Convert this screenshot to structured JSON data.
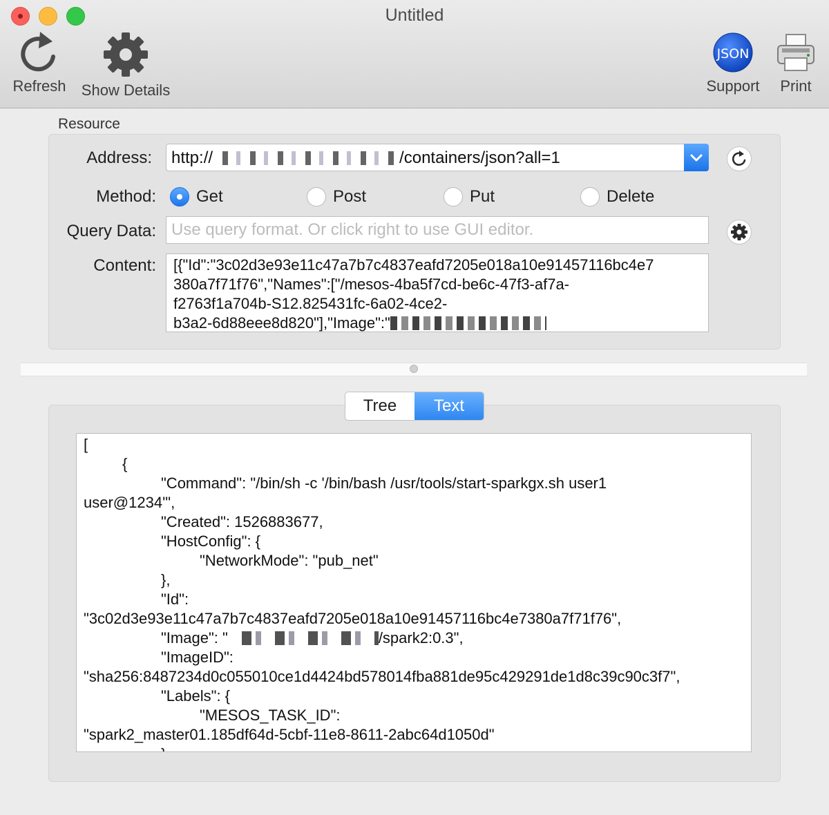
{
  "window": {
    "title": "Untitled"
  },
  "toolbar": {
    "refresh_label": "Refresh",
    "details_label": "Show Details",
    "support_label": "Support",
    "print_label": "Print",
    "support_badge": "JSON"
  },
  "resource": {
    "group_title": "Resource",
    "address_label": "Address:",
    "address_prefix": "http://",
    "address_suffix": "/containers/json?all=1",
    "method_label": "Method:",
    "methods": [
      "Get",
      "Post",
      "Put",
      "Delete"
    ],
    "selected_method": "Get",
    "query_label": "Query Data:",
    "query_placeholder": "Use query format. Or click right to use GUI editor.",
    "query_value": "",
    "content_label": "Content:",
    "content_lines": [
      "[{\"Id\":\"3c02d3e93e11c47a7b7c4837eafd7205e018a10e91457116bc4e7",
      "380a7f71f76\",\"Names\":[\"/mesos-4ba5f7cd-be6c-47f3-af7a-",
      "f2763f1a704b-S12.825431fc-6a02-4ce2-",
      "b3a2-6d88eee8d820\"],\"Image\":\""
    ]
  },
  "view_tabs": {
    "tree": "Tree",
    "text": "Text",
    "active": "Text"
  },
  "result": {
    "lines": [
      "[",
      "{",
      "\"Command\": \"/bin/sh -c '/bin/bash  /usr/tools/start-sparkgx.sh user1",
      "user@1234'\",",
      "\"Created\": 1526883677,",
      "\"HostConfig\": {",
      "\"NetworkMode\": \"pub_net\"",
      "},",
      "\"Id\":",
      "\"3c02d3e93e11c47a7b7c4837eafd7205e018a10e91457116bc4e7380a7f71f76\",",
      "\"Image\": \"",
      "/spark2:0.3\",",
      "\"ImageID\":",
      "\"sha256:8487234d0c055010ce1d4424bd578014fba881de95c429291de1d8c39c90c3f7\",",
      "\"Labels\": {",
      "\"MESOS_TASK_ID\":",
      "\"spark2_master01.185df64d-5cbf-11e8-8611-2abc64d1050d\"",
      "},"
    ]
  },
  "colors": {
    "accent": "#1d77ec",
    "close": "#fc605c",
    "minimize": "#fdbc40",
    "zoom": "#34c84a"
  },
  "icons": [
    "refresh-icon",
    "gear-icon",
    "json-logo-icon",
    "printer-icon",
    "reload-icon",
    "chevron-down-icon"
  ]
}
